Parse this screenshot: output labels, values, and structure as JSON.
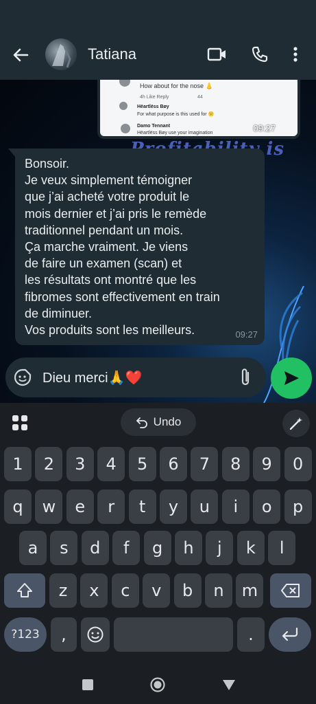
{
  "header": {
    "contact_name": "Tatiana",
    "icons": [
      "back-arrow-icon",
      "video-call-icon",
      "voice-call-icon",
      "more-vert-icon"
    ]
  },
  "media_preview": {
    "comment_1": "How about for the nose 👃",
    "comment_1_meta": "4h   Like   Reply",
    "comment_1_count": "44",
    "comment_2_author": "Hëartlëss Bøy",
    "comment_2_text": "For what purpose is this used for 😕",
    "comment_3_author": "Damo Tennant",
    "comment_3_text": "Hëartlëss Bøy use your imagination",
    "time": "09:27",
    "banner_text": "Profitability is"
  },
  "message": {
    "text": "Bonsoir.\nJe veux simplement témoigner\nque j’ai acheté votre produit le\nmois dernier et j’ai pris le remède\ntraditionnel pendant un mois.\nÇa marche vraiment. Je viens\nde faire un examen (scan) et\nles résultats ont montré que les\nfibromes sont effectivement en train\nde diminuer.\nVos produits sont les meilleurs.",
    "time": "09:27"
  },
  "composer": {
    "value": "Dieu merci🙏❤️",
    "icons": [
      "sticker-icon",
      "attach-icon",
      "send-icon"
    ]
  },
  "keyboard": {
    "undo_label": "Undo",
    "row_numbers": [
      "1",
      "2",
      "3",
      "4",
      "5",
      "6",
      "7",
      "8",
      "9",
      "0"
    ],
    "row_1": [
      "q",
      "w",
      "e",
      "r",
      "t",
      "y",
      "u",
      "i",
      "o",
      "p"
    ],
    "row_2": [
      "a",
      "s",
      "d",
      "f",
      "g",
      "h",
      "j",
      "k",
      "l"
    ],
    "row_3": [
      "z",
      "x",
      "c",
      "v",
      "b",
      "n",
      "m"
    ],
    "symbols_label": "?123",
    "comma_label": ",",
    "period_label": "."
  },
  "colors": {
    "header_bg": "#1f2c34",
    "bubble_bg": "#1f2c34",
    "send_green": "#21c063",
    "keyboard_bg": "#1b1f24",
    "key_bg": "#3a3f46"
  }
}
